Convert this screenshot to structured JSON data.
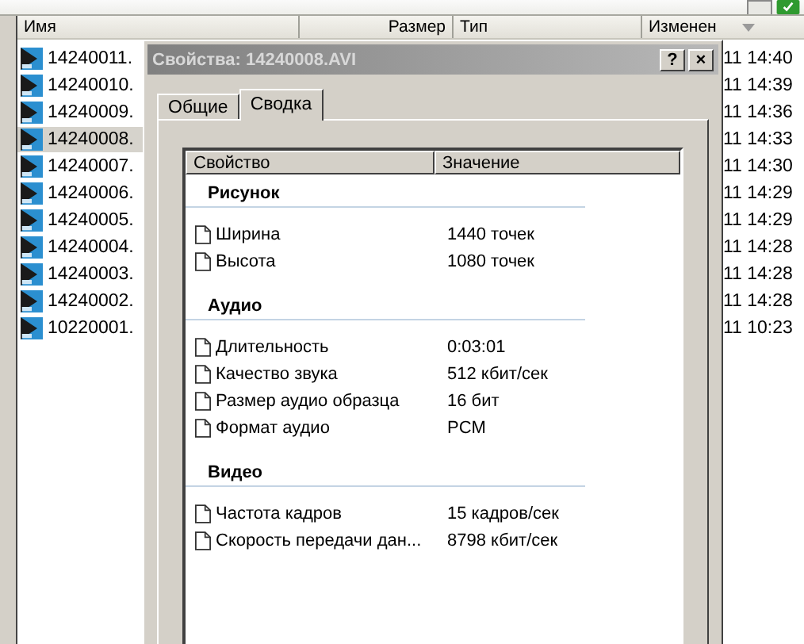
{
  "explorer": {
    "columns": [
      {
        "label": "Имя",
        "sorted": false
      },
      {
        "label": "Размер",
        "sorted": false
      },
      {
        "label": "Тип",
        "sorted": false
      },
      {
        "label": "Изменен",
        "sorted": true
      }
    ],
    "files": [
      {
        "name": "14240011.",
        "modified": "11 14:40",
        "selected": false
      },
      {
        "name": "14240010.",
        "modified": "11 14:39",
        "selected": false
      },
      {
        "name": "14240009.",
        "modified": "11 14:36",
        "selected": false
      },
      {
        "name": "14240008.",
        "modified": "11 14:33",
        "selected": true
      },
      {
        "name": "14240007.",
        "modified": "11 14:30",
        "selected": false
      },
      {
        "name": "14240006.",
        "modified": "11 14:29",
        "selected": false
      },
      {
        "name": "14240005.",
        "modified": "11 14:29",
        "selected": false
      },
      {
        "name": "14240004.",
        "modified": "11 14:28",
        "selected": false
      },
      {
        "name": "14240003.",
        "modified": "11 14:28",
        "selected": false
      },
      {
        "name": "14240002.",
        "modified": "11 14:28",
        "selected": false
      },
      {
        "name": "10220001.",
        "modified": "11 10:23",
        "selected": false
      }
    ]
  },
  "dialog": {
    "title": "Свойства: 14240008.AVI",
    "title_buttons": [
      "?",
      "×"
    ],
    "tabs": [
      {
        "label": "Общие",
        "selected": false
      },
      {
        "label": "Сводка",
        "selected": true
      }
    ],
    "columns": [
      "Свойство",
      "Значение"
    ],
    "groups": [
      {
        "title": "Рисунок",
        "properties": [
          {
            "name": "Ширина",
            "value": "1440 точек"
          },
          {
            "name": "Высота",
            "value": "1080 точек"
          }
        ]
      },
      {
        "title": "Аудио",
        "properties": [
          {
            "name": "Длительность",
            "value": "0:03:01"
          },
          {
            "name": "Качество звука",
            "value": "512 кбит/сек"
          },
          {
            "name": "Размер аудио образца",
            "value": "16 бит"
          },
          {
            "name": "Формат аудио",
            "value": "PCM"
          }
        ]
      },
      {
        "title": "Видео",
        "properties": [
          {
            "name": "Частота кадров",
            "value": "15 кадров/сек"
          },
          {
            "name": "Скорость передачи дан...",
            "value": "8798 кбит/сек"
          }
        ]
      }
    ]
  }
}
